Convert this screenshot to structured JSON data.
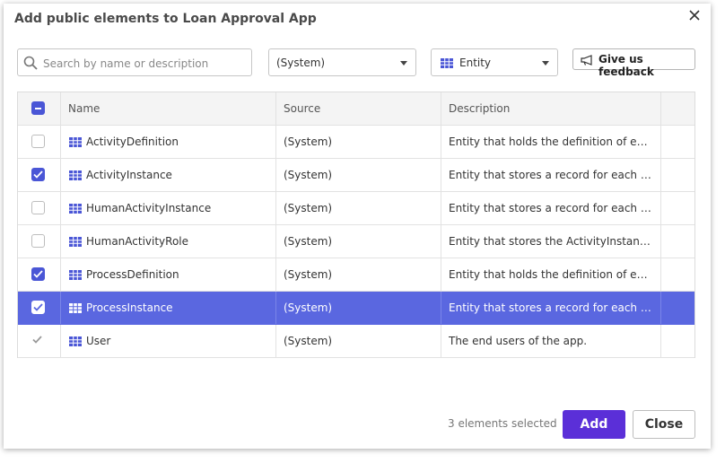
{
  "dialog": {
    "title": "Add public elements to Loan Approval App",
    "close_icon": "close-icon"
  },
  "toolbar": {
    "search_placeholder": "Search by name or description",
    "search_value": "",
    "source_selected": "(System)",
    "type_selected": "Entity",
    "feedback_label": "Give us feedback"
  },
  "table": {
    "columns": [
      "Name",
      "Source",
      "Description"
    ],
    "rows": [
      {
        "name": "ActivityDefinition",
        "source": "(System)",
        "description": "Entity that holds the definition of each activity of a process.",
        "checked": false,
        "state": "normal"
      },
      {
        "name": "ActivityInstance",
        "source": "(System)",
        "description": "Entity that stores a record for each activity instance.",
        "checked": true,
        "state": "normal"
      },
      {
        "name": "HumanActivityInstance",
        "source": "(System)",
        "description": "Entity that stores a record for each human activity instance.",
        "checked": false,
        "state": "normal"
      },
      {
        "name": "HumanActivityRole",
        "source": "(System)",
        "description": "Entity that stores the ActivityInstanceId and role of human activities.",
        "checked": false,
        "state": "normal"
      },
      {
        "name": "ProcessDefinition",
        "source": "(System)",
        "description": "Entity that holds the definition of each process.",
        "checked": true,
        "state": "normal"
      },
      {
        "name": "ProcessInstance",
        "source": "(System)",
        "description": "Entity that stores a record for each activity instance.",
        "checked": true,
        "state": "selected"
      },
      {
        "name": "User",
        "source": "(System)",
        "description": "The end users of the app.",
        "checked": true,
        "state": "disabled"
      }
    ]
  },
  "footer": {
    "count_text": "3 elements selected",
    "add_label": "Add",
    "close_label": "Close"
  },
  "colors": {
    "accent": "#5b2fd8",
    "selected_row": "#5a67e0",
    "checkbox": "#4a56d6"
  }
}
